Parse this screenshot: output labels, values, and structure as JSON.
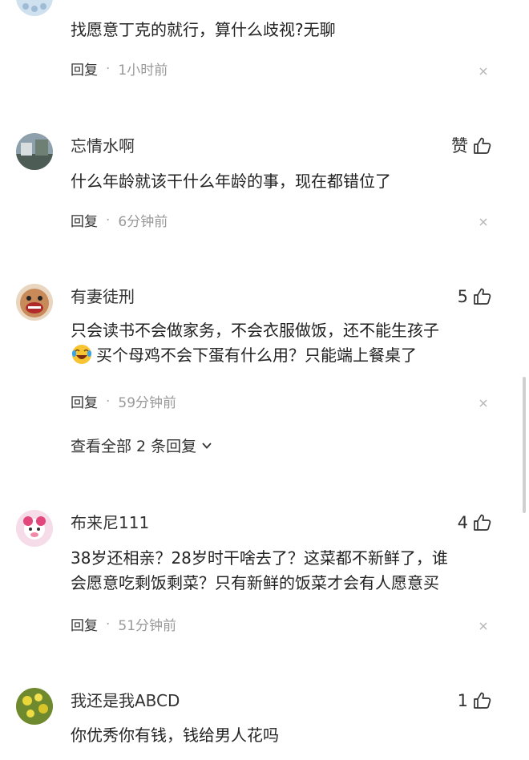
{
  "comments": [
    {
      "content": [
        "找愿意丁克的就行，算什么歧视?无聊"
      ],
      "reply_label": "回复",
      "time": "1小时前"
    },
    {
      "username": "忘情水啊",
      "like_label": "赞",
      "content": [
        "什么年龄就该干什么年龄的事，现在都错位了"
      ],
      "reply_label": "回复",
      "time": "6分钟前"
    },
    {
      "username": "有妻徒刑",
      "like_count": "5",
      "content": [
        "只会读书不会做家务，不会衣服做饭，还不能生孩子",
        "买个母鸡不会下蛋有什么用？只能端上餐桌了"
      ],
      "emoji_icon": "laughing-crying-emoji-icon",
      "reply_label": "回复",
      "time": "59分钟前",
      "view_all_label": "查看全部 2 条回复"
    },
    {
      "username": "布来尼111",
      "like_count": "4",
      "content": [
        "38岁还相亲？28岁时干啥去了？这菜都不新鲜了，谁",
        "会愿意吃剩饭剩菜？只有新鲜的饭菜才会有人愿意买"
      ],
      "reply_label": "回复",
      "time": "51分钟前"
    },
    {
      "username": "我还是我ABCD",
      "like_count": "1",
      "content": [
        "你优秀你有钱，钱给男人花吗"
      ]
    }
  ],
  "colors": {
    "text": "#222222",
    "muted": "#999999",
    "dot": "#aaaaaa"
  }
}
